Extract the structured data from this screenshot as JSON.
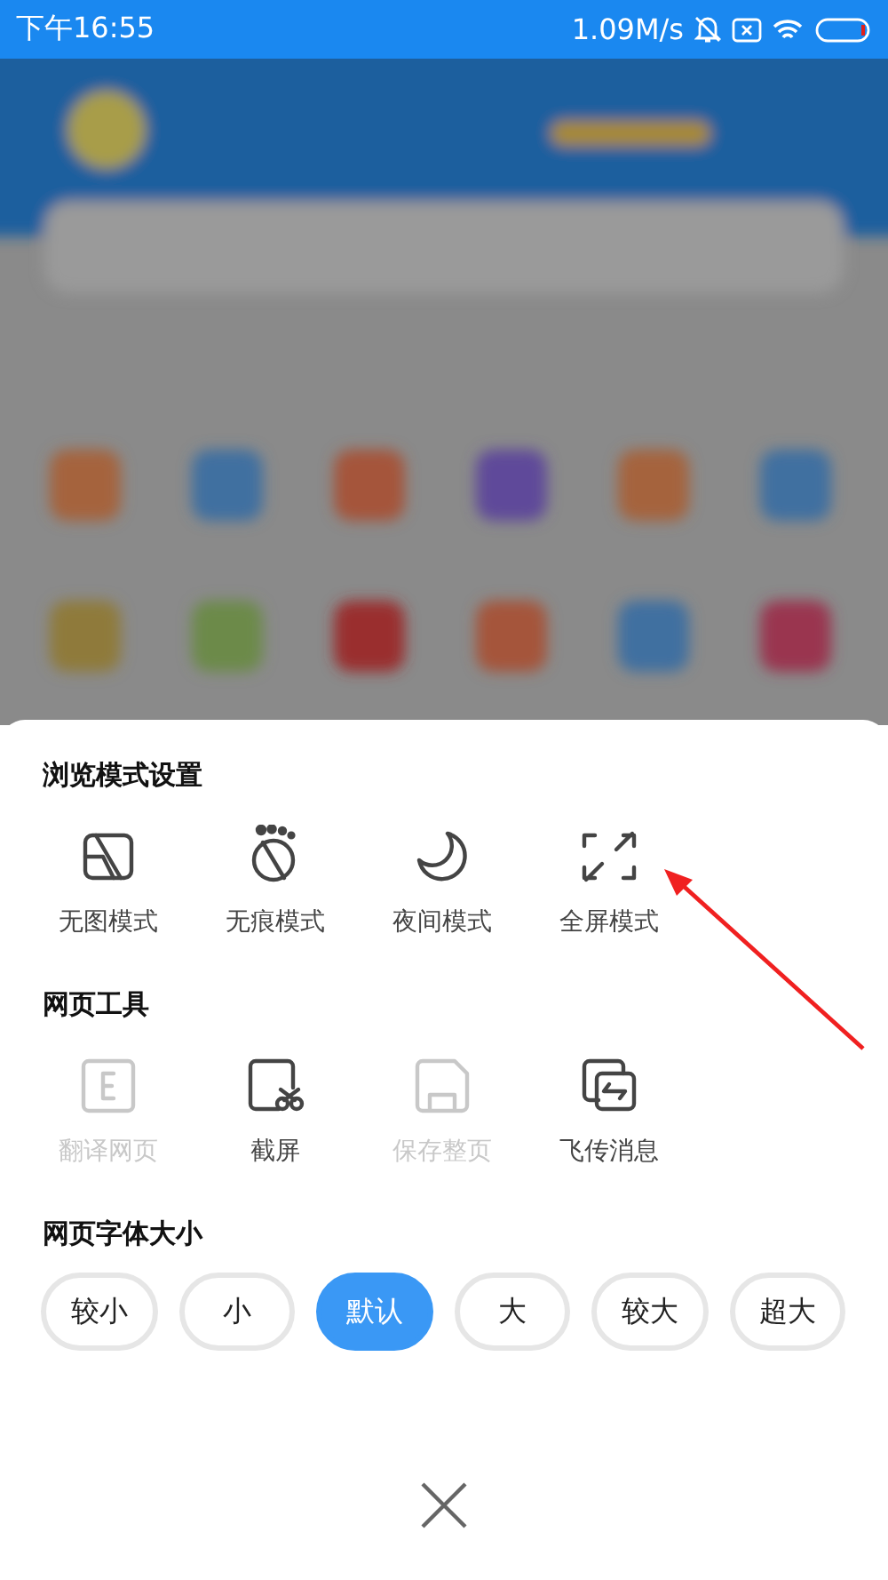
{
  "status_bar": {
    "time": "下午16:55",
    "speed": "1.09M/s"
  },
  "sheet": {
    "sections": [
      {
        "kind": "modes",
        "title": "浏览模式设置",
        "items": [
          {
            "label": "无图模式",
            "disabled": false
          },
          {
            "label": "无痕模式",
            "disabled": false
          },
          {
            "label": "夜间模式",
            "disabled": false
          },
          {
            "label": "全屏模式",
            "disabled": false
          }
        ]
      },
      {
        "kind": "tools",
        "title": "网页工具",
        "items": [
          {
            "label": "翻译网页",
            "disabled": true
          },
          {
            "label": "截屏",
            "disabled": false
          },
          {
            "label": "保存整页",
            "disabled": true
          },
          {
            "label": "飞传消息",
            "disabled": false
          }
        ]
      },
      {
        "kind": "font_size",
        "title": "网页字体大小",
        "options": [
          {
            "label": "较小",
            "selected": false
          },
          {
            "label": "小",
            "selected": false
          },
          {
            "label": "默认",
            "selected": true
          },
          {
            "label": "大",
            "selected": false
          },
          {
            "label": "较大",
            "selected": false
          },
          {
            "label": "超大",
            "selected": false
          }
        ]
      }
    ]
  }
}
